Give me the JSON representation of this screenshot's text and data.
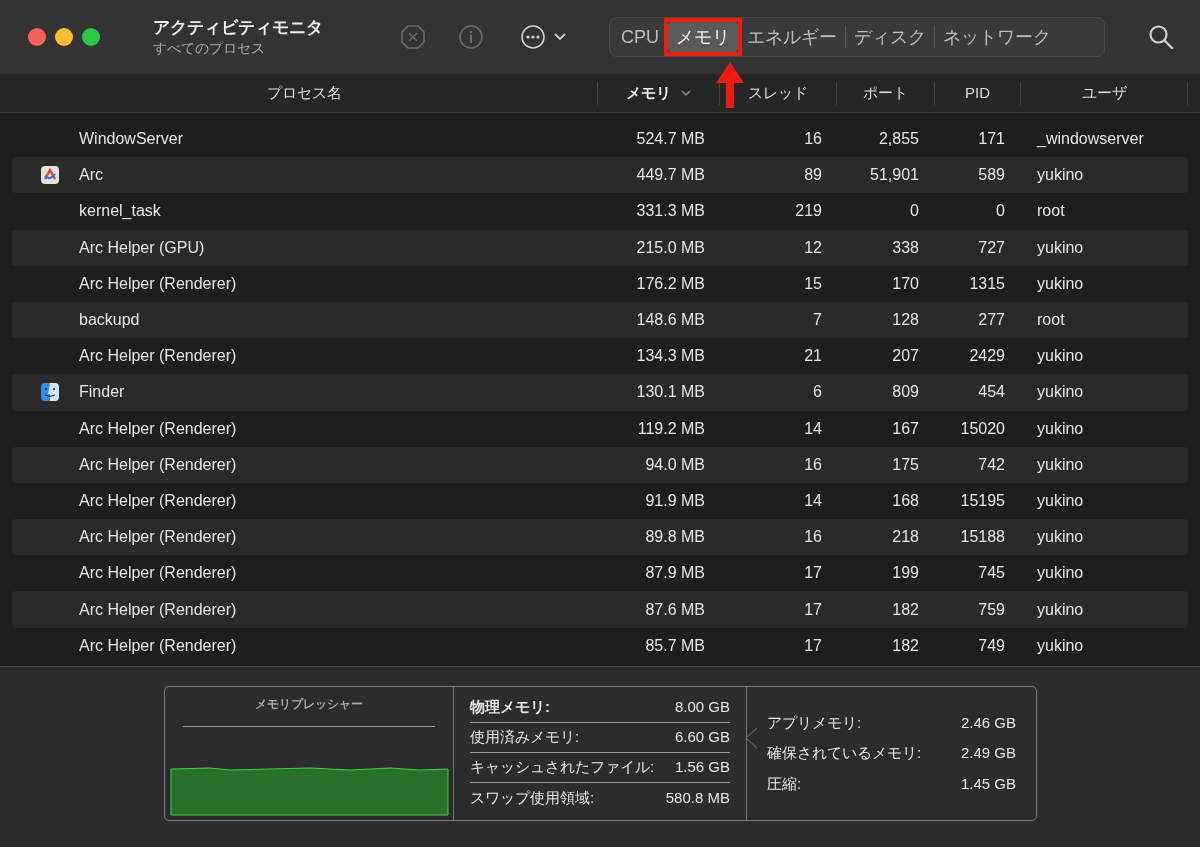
{
  "window": {
    "title": "アクティビティモニタ",
    "subtitle": "すべてのプロセス"
  },
  "tabs": [
    {
      "label": "CPU",
      "selected": false,
      "highlighted": false
    },
    {
      "label": "メモリ",
      "selected": true,
      "highlighted": true
    },
    {
      "label": "エネルギー",
      "selected": false,
      "highlighted": false
    },
    {
      "label": "ディスク",
      "selected": false,
      "highlighted": false
    },
    {
      "label": "ネットワーク",
      "selected": false,
      "highlighted": false
    }
  ],
  "table": {
    "columns": [
      {
        "label": "プロセス名",
        "sorted": false
      },
      {
        "label": "メモリ",
        "sorted": true
      },
      {
        "label": "スレッド",
        "sorted": false
      },
      {
        "label": "ポート",
        "sorted": false
      },
      {
        "label": "PID",
        "sorted": false
      },
      {
        "label": "ユーザ",
        "sorted": false
      }
    ],
    "rows": [
      {
        "kind": "none",
        "name": "WindowServer",
        "memory": "524.7 MB",
        "threads": "16",
        "ports": "2,855",
        "pid": "171",
        "user": "_windowserver"
      },
      {
        "kind": "arc",
        "name": "Arc",
        "memory": "449.7 MB",
        "threads": "89",
        "ports": "51,901",
        "pid": "589",
        "user": "yukino"
      },
      {
        "kind": "none",
        "name": "kernel_task",
        "memory": "331.3 MB",
        "threads": "219",
        "ports": "0",
        "pid": "0",
        "user": "root"
      },
      {
        "kind": "none",
        "name": "Arc Helper (GPU)",
        "memory": "215.0 MB",
        "threads": "12",
        "ports": "338",
        "pid": "727",
        "user": "yukino"
      },
      {
        "kind": "none",
        "name": "Arc Helper (Renderer)",
        "memory": "176.2 MB",
        "threads": "15",
        "ports": "170",
        "pid": "1315",
        "user": "yukino"
      },
      {
        "kind": "none",
        "name": "backupd",
        "memory": "148.6 MB",
        "threads": "7",
        "ports": "128",
        "pid": "277",
        "user": "root"
      },
      {
        "kind": "none",
        "name": "Arc Helper (Renderer)",
        "memory": "134.3 MB",
        "threads": "21",
        "ports": "207",
        "pid": "2429",
        "user": "yukino"
      },
      {
        "kind": "finder",
        "name": "Finder",
        "memory": "130.1 MB",
        "threads": "6",
        "ports": "809",
        "pid": "454",
        "user": "yukino"
      },
      {
        "kind": "none",
        "name": "Arc Helper (Renderer)",
        "memory": "119.2 MB",
        "threads": "14",
        "ports": "167",
        "pid": "15020",
        "user": "yukino"
      },
      {
        "kind": "none",
        "name": "Arc Helper (Renderer)",
        "memory": "94.0 MB",
        "threads": "16",
        "ports": "175",
        "pid": "742",
        "user": "yukino"
      },
      {
        "kind": "none",
        "name": "Arc Helper (Renderer)",
        "memory": "91.9 MB",
        "threads": "14",
        "ports": "168",
        "pid": "15195",
        "user": "yukino"
      },
      {
        "kind": "none",
        "name": "Arc Helper (Renderer)",
        "memory": "89.8 MB",
        "threads": "16",
        "ports": "218",
        "pid": "15188",
        "user": "yukino"
      },
      {
        "kind": "none",
        "name": "Arc Helper (Renderer)",
        "memory": "87.9 MB",
        "threads": "17",
        "ports": "199",
        "pid": "745",
        "user": "yukino"
      },
      {
        "kind": "none",
        "name": "Arc Helper (Renderer)",
        "memory": "87.6 MB",
        "threads": "17",
        "ports": "182",
        "pid": "759",
        "user": "yukino"
      },
      {
        "kind": "none",
        "name": "Arc Helper (Renderer)",
        "memory": "85.7 MB",
        "threads": "17",
        "ports": "182",
        "pid": "749",
        "user": "yukino"
      }
    ]
  },
  "memory_panel": {
    "pressure_title": "メモリプレッシャー",
    "stats": [
      {
        "label": "物理メモリ:",
        "value": "8.00 GB",
        "bold": true,
        "pointed": false
      },
      {
        "label": "使用済みメモリ:",
        "value": "6.60 GB",
        "bold": false,
        "pointed": true
      },
      {
        "label": "キャッシュされたファイル:",
        "value": "1.56 GB",
        "bold": false,
        "pointed": false
      },
      {
        "label": "スワップ使用領域:",
        "value": "580.8 MB",
        "bold": false,
        "pointed": false
      }
    ],
    "breakdown": [
      {
        "label": "アプリメモリ:",
        "value": "2.46 GB"
      },
      {
        "label": "確保されているメモリ:",
        "value": "2.49 GB"
      },
      {
        "label": "圧縮:",
        "value": "1.45 GB"
      }
    ]
  }
}
